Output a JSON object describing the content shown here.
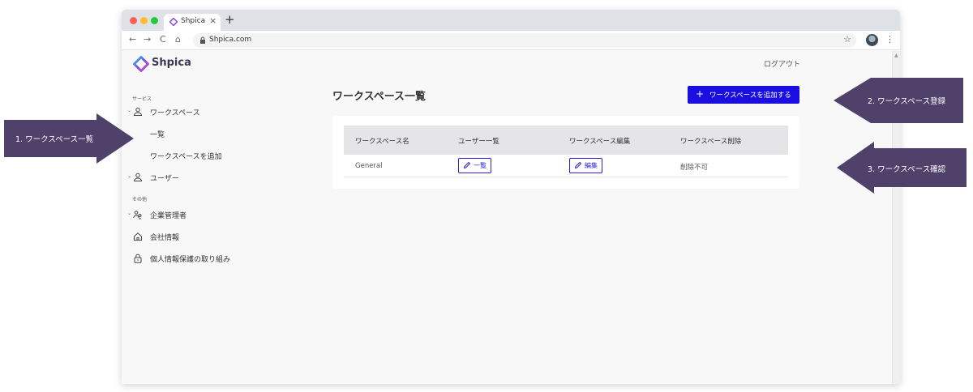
{
  "browser": {
    "tab_title": "Shpica",
    "tab_close": "×",
    "new_tab": "+",
    "url": "Shpica.com",
    "back": "←",
    "forward": "→",
    "reload": "C",
    "home": "⌂",
    "star": "☆",
    "menu": "⋮"
  },
  "header": {
    "logo_text": "Shpica",
    "logout": "ログアウト"
  },
  "sidebar": {
    "section_service": "サービス",
    "workspace": "ワークスペース",
    "workspace_list": "一覧",
    "workspace_add": "ワークスペースを追加",
    "user": "ユーザー",
    "section_other": "その他",
    "company_admin": "企業管理者",
    "company_info": "会社情報",
    "privacy": "個人情報保護の取り組み"
  },
  "main": {
    "title": "ワークスペース一覧",
    "add_button": "ワークスペースを追加する",
    "table": {
      "headers": [
        "ワークスペース名",
        "ユーザー一覧",
        "ワークスペース編集",
        "ワークスペース削除"
      ],
      "rows": [
        {
          "name": "General",
          "users_btn": "一覧",
          "edit_btn": "編集",
          "delete": "削除不可"
        }
      ]
    }
  },
  "callouts": {
    "c1": "1. ワークスペース一覧",
    "c2": "2. ワークスペース登録",
    "c3": "3. ワークスペース確認"
  },
  "colors": {
    "primary": "#1a0fe0",
    "callout": "#4f4169"
  }
}
